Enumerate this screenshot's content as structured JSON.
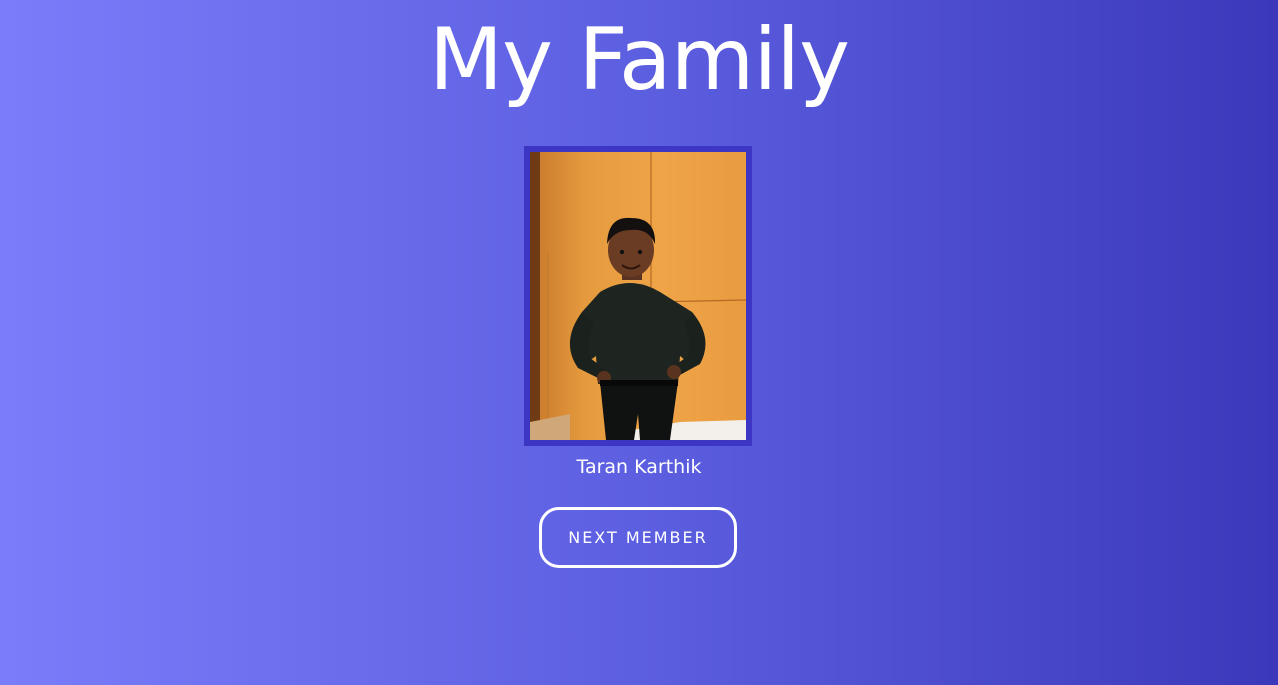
{
  "page": {
    "title": "My Family"
  },
  "member": {
    "name": "Taran Karthik",
    "photo_alt": "Taran Karthik",
    "photo_icon": "portrait-photo"
  },
  "actions": {
    "next_label": "NEXT MEMBER"
  },
  "colors": {
    "background_left": "#7b7cfa",
    "background_right": "#3c38bb",
    "photo_frame": "#3d35c4",
    "text": "#ffffff"
  }
}
